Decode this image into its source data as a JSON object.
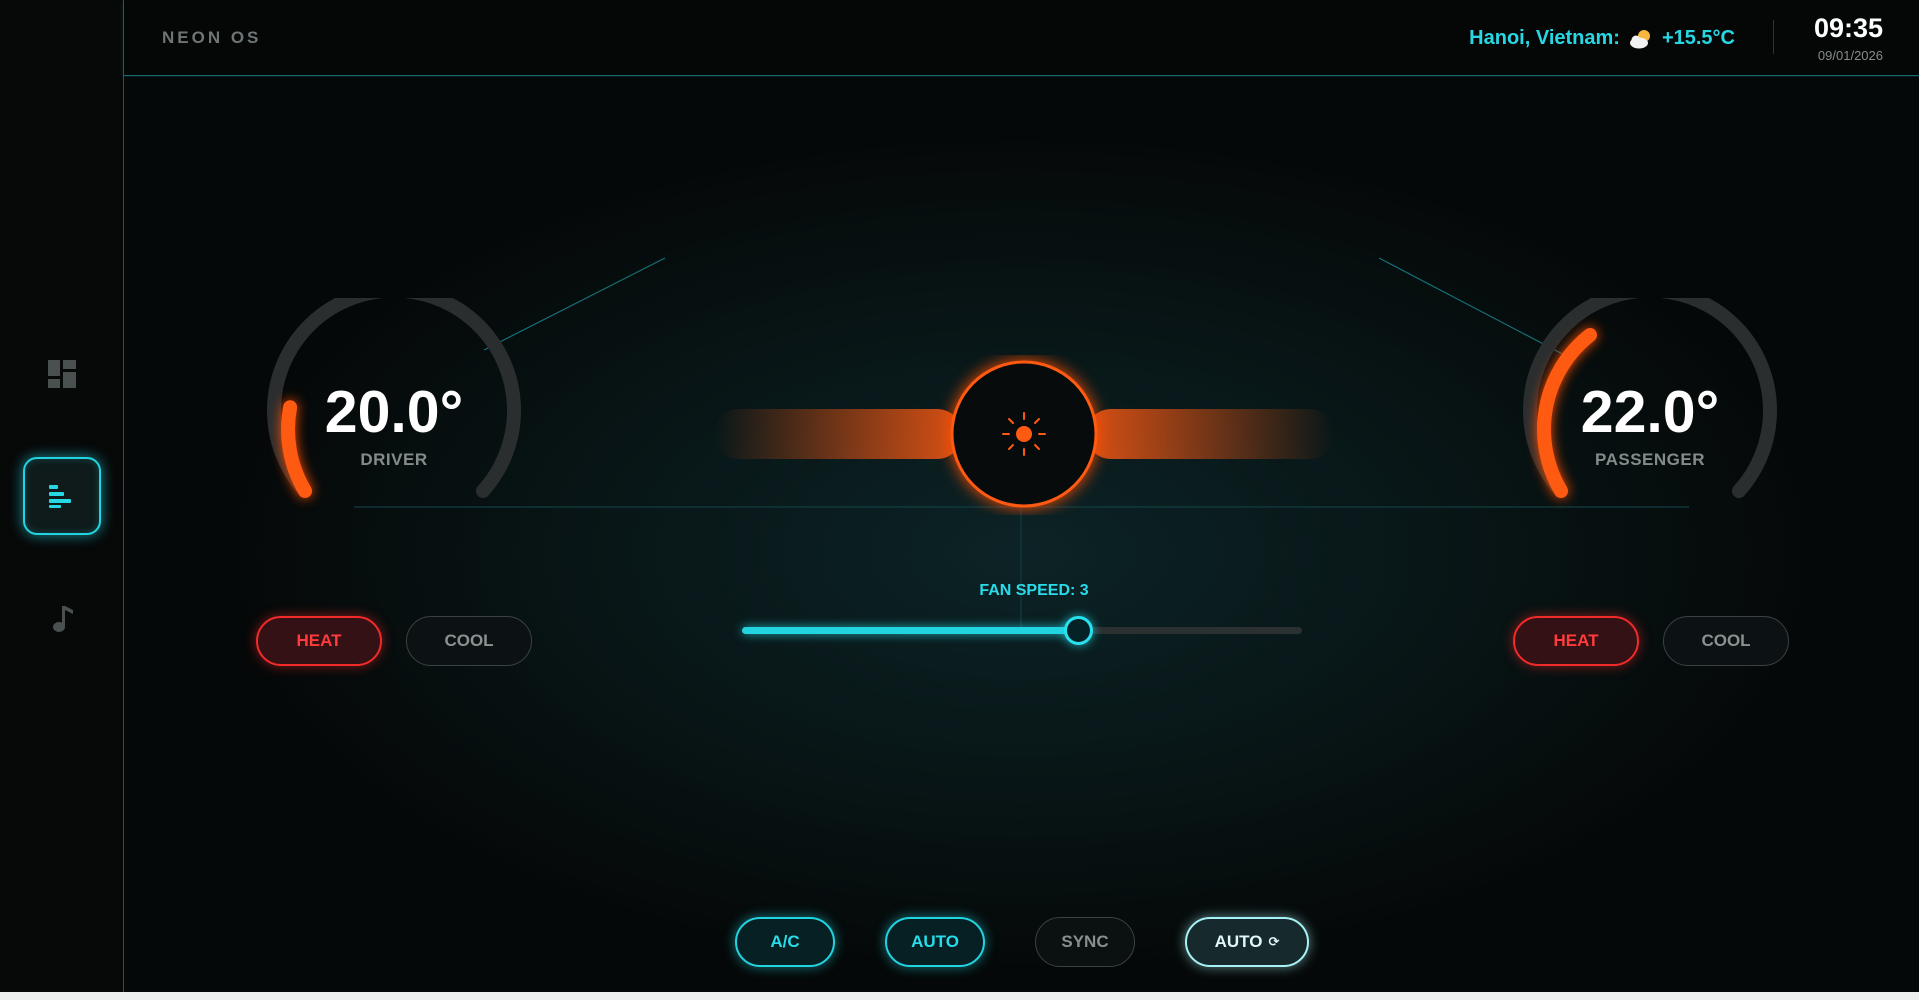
{
  "header": {
    "brand": "NEON OS",
    "weather_text": "Hanoi, Vietnam:",
    "weather_icon": "partly-cloudy-icon",
    "weather_temp": "+15.5°C",
    "time": "09:35",
    "date": "09/01/2026"
  },
  "sidebar": {
    "items": [
      {
        "icon": "dashboard-icon",
        "active": false
      },
      {
        "icon": "climate-bars-icon",
        "active": true
      },
      {
        "icon": "music-note-icon",
        "active": false
      }
    ]
  },
  "driver": {
    "temp": "20.0°",
    "label": "DRIVER",
    "heat_label": "HEAT",
    "cool_label": "COOL",
    "mode": "heat"
  },
  "passenger": {
    "temp": "22.0°",
    "label": "PASSENGER",
    "heat_label": "HEAT",
    "cool_label": "COOL",
    "mode": "heat"
  },
  "center": {
    "icon": "sun-icon"
  },
  "fan": {
    "label": "FAN SPEED: 3",
    "level": 3,
    "fraction": 0.6
  },
  "controls": {
    "ac_label": "A/C",
    "auto_label": "AUTO",
    "sync_label": "SYNC",
    "auto_recirc_label": "AUTO"
  },
  "colors": {
    "accent": "#22d3e0",
    "heat": "#ff3b3b",
    "warm": "#ff5a12"
  }
}
